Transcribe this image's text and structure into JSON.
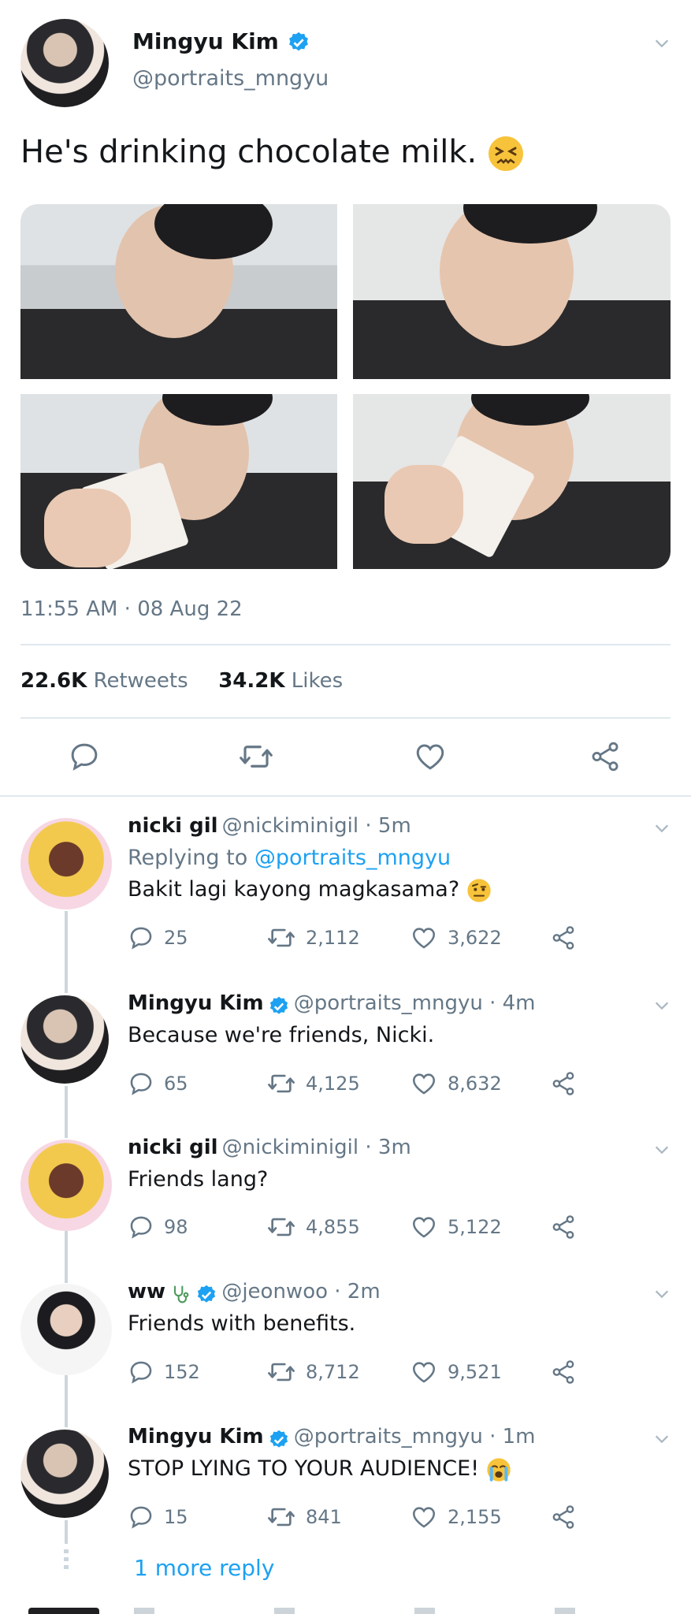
{
  "main_tweet": {
    "author": "Mingyu Kim",
    "handle": "@portraits_mngyu",
    "text": "He's drinking chocolate milk.",
    "time": "11:55 AM · 08 Aug 22",
    "retweets": "22.6K",
    "retweets_label": "Retweets",
    "likes": "34.2K",
    "likes_label": "Likes"
  },
  "replies": [
    {
      "name": "nicki gil",
      "handle": "@nickiminigil · 5m",
      "replying_prefix": "Replying to",
      "replying_to": "@portraits_mngyu",
      "text": "Bakit lagi kayong magkasama?",
      "reply_count": "25",
      "retweet_count": "2,112",
      "like_count": "3,622"
    },
    {
      "name": "Mingyu Kim",
      "handle": "@portraits_mngyu · 4m",
      "text": "Because we're friends, Nicki.",
      "reply_count": "65",
      "retweet_count": "4,125",
      "like_count": "8,632"
    },
    {
      "name": "nicki gil",
      "handle": "@nickiminigil · 3m",
      "text": "Friends lang?",
      "reply_count": "98",
      "retweet_count": "4,855",
      "like_count": "5,122"
    },
    {
      "name": "ww",
      "handle": "@jeonwoo · 2m",
      "text": "Friends with benefits.",
      "reply_count": "152",
      "retweet_count": "8,712",
      "like_count": "9,521"
    },
    {
      "name": "Mingyu Kim",
      "handle": "@portraits_mngyu · 1m",
      "text": "STOP LYING TO YOUR AUDIENCE!",
      "reply_count": "15",
      "retweet_count": "841",
      "like_count": "2,155"
    }
  ],
  "more_replies": "1 more reply",
  "colors": {
    "accent": "#1da1f2",
    "muted": "#657786",
    "divider": "#e1e8ed"
  }
}
